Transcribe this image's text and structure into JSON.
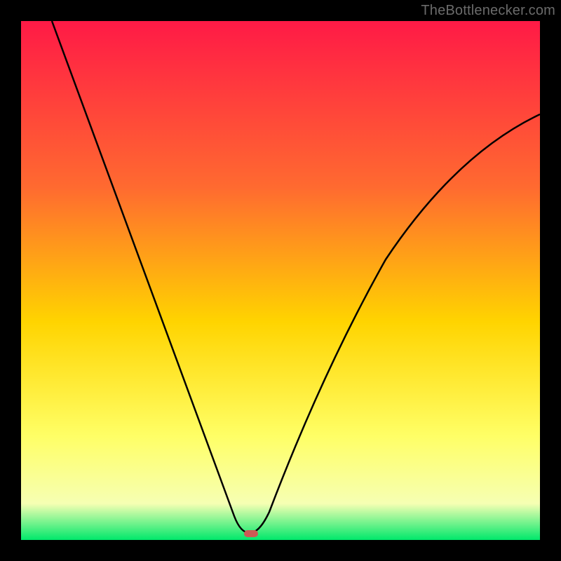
{
  "watermark": "TheBottlenecker.com",
  "colors": {
    "black": "#000000",
    "curve": "#000000",
    "grad_top": "#ff1a46",
    "grad_a": "#ff6a30",
    "grad_mid": "#ffd400",
    "grad_b": "#ffff66",
    "grad_c": "#f6ffb3",
    "grad_bot": "#00e86b",
    "marker": "#cc5a55"
  },
  "chart_data": {
    "type": "line",
    "title": "",
    "xlabel": "",
    "ylabel": "",
    "xlim": [
      0,
      100
    ],
    "ylim": [
      0,
      100
    ],
    "minimum": {
      "x": 44,
      "y": 0
    },
    "left_branch": {
      "x_start": 6,
      "y_start": 100,
      "x_end": 44,
      "y_end": 0
    },
    "right_branch": {
      "x_start": 44,
      "y_start": 0,
      "x_end": 100,
      "y_end": 82
    },
    "annotations": [
      "V-shaped bottleneck curve on red→green gradient"
    ]
  }
}
